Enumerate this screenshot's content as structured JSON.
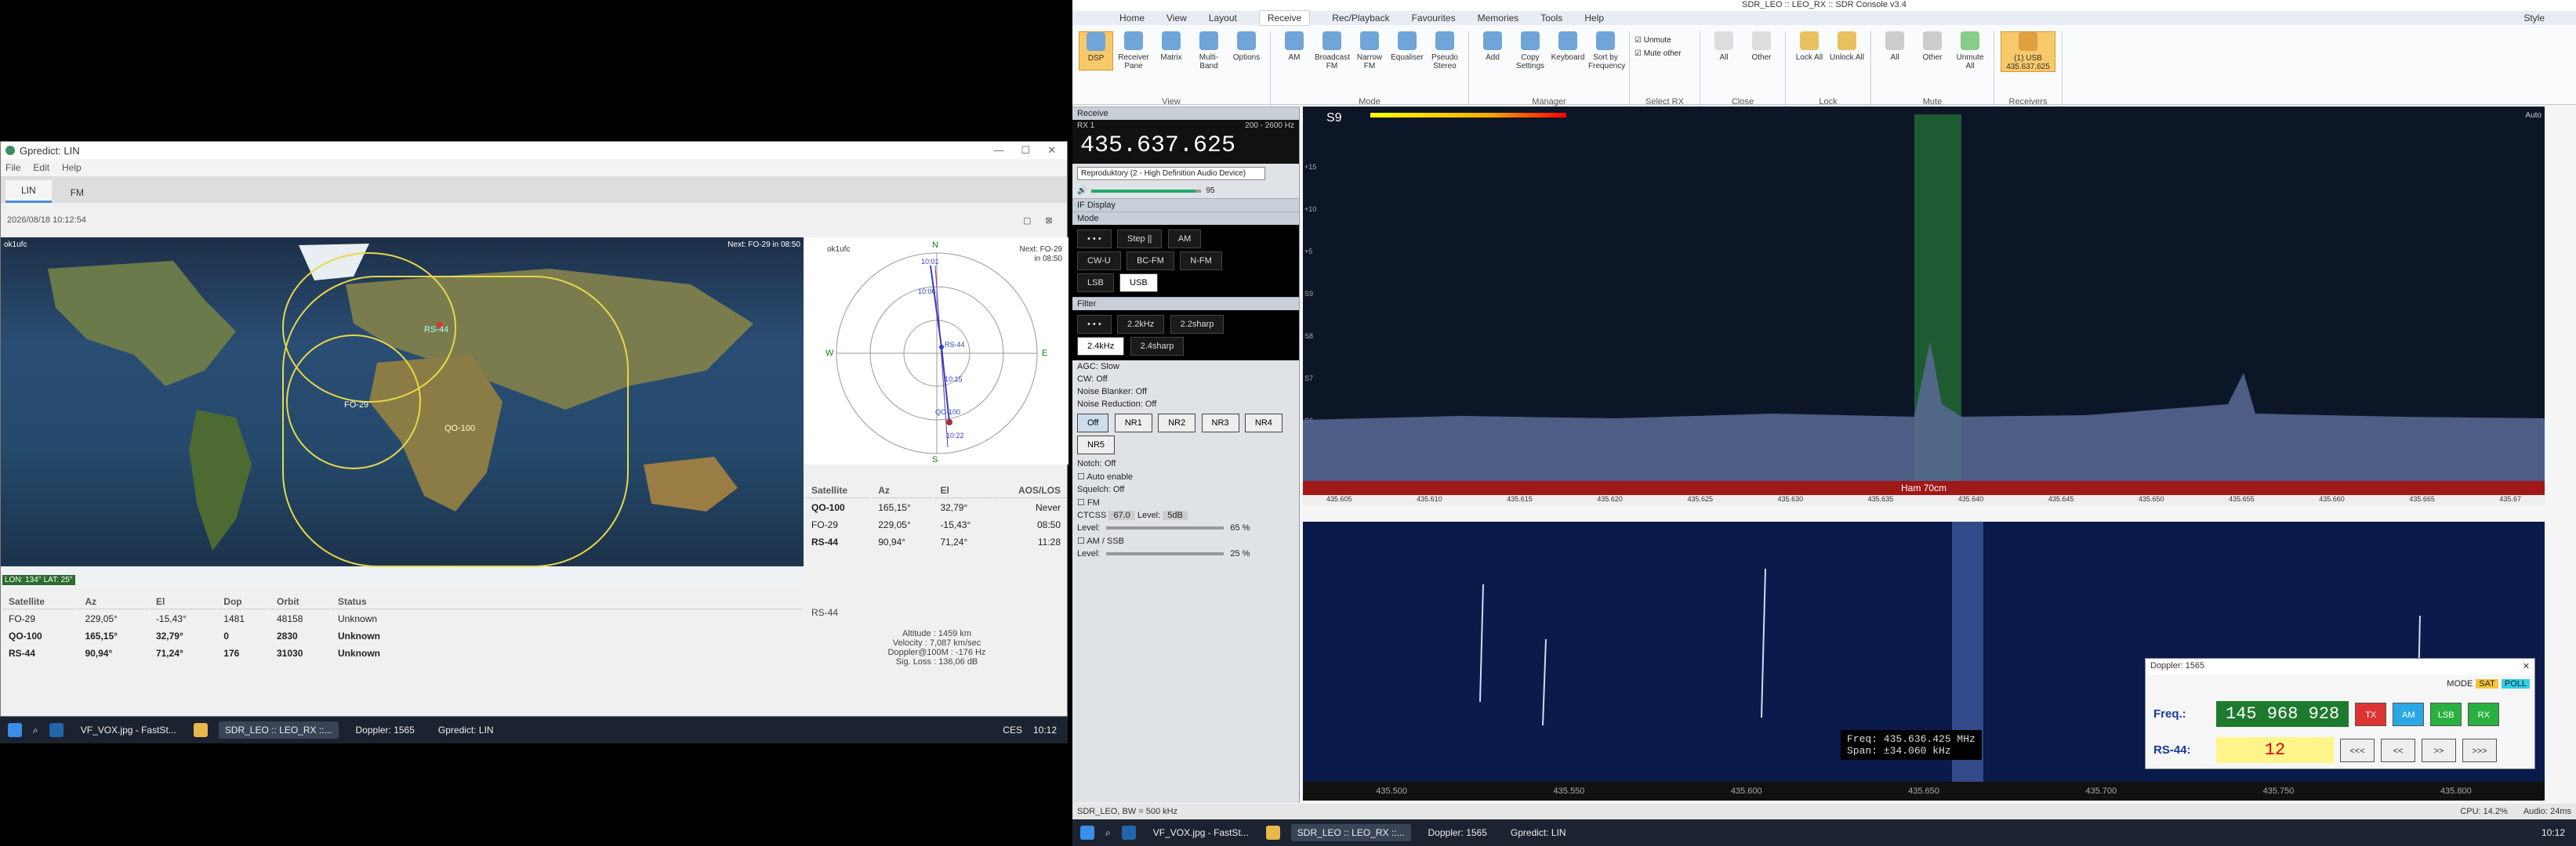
{
  "gpredict": {
    "title": "Gpredict: LIN",
    "menu": [
      "File",
      "Edit",
      "Help"
    ],
    "tabs": [
      "LIN",
      "FM"
    ],
    "datetime": "2026/08/18 10:12:54",
    "map": {
      "qth": "ok1ufc",
      "next": "Next: FO-29 in 08:50",
      "coords": "LON: 134° LAT: 25°",
      "sat_labels": [
        "FO-29",
        "QO-100",
        "RS-44"
      ]
    },
    "polar": {
      "qth": "ok1ufc",
      "next_line1": "Next: FO-29",
      "next_line2": "in 08:50",
      "n": "N",
      "s": "S",
      "e": "E",
      "w": "W",
      "labels": [
        "10:01",
        "10:06",
        "RS-44",
        "10:15",
        "QO-100",
        "10:22"
      ]
    },
    "sky_table": {
      "headers": [
        "Satellite",
        "Az",
        "El",
        "AOS/LOS"
      ],
      "rows": [
        [
          "QO-100",
          "165,15°",
          "32,79°",
          "Never"
        ],
        [
          "FO-29",
          "229,05°",
          "-15,43°",
          "08:50"
        ],
        [
          "RS-44",
          "90,94°",
          "71,24°",
          "11:28"
        ]
      ]
    },
    "list_table": {
      "headers": [
        "Satellite",
        "Az",
        "El",
        "Dop",
        "Orbit",
        "Status"
      ],
      "rows": [
        [
          "FO-29",
          "229,05°",
          "-15,43°",
          "1481",
          "48158",
          "Unknown"
        ],
        [
          "QO-100",
          "165,15°",
          "32,79°",
          "0",
          "2830",
          "Unknown"
        ],
        [
          "RS-44",
          "90,94°",
          "71,24°",
          "176",
          "31030",
          "Unknown"
        ]
      ]
    },
    "details": {
      "name": "RS-44",
      "altitude": "Altitude : 1459 km",
      "velocity": "Velocity : 7,087 km/sec",
      "doppler": "Doppler@100M : -176 Hz",
      "sigloss": "Sig. Loss : 136,06 dB"
    }
  },
  "taskbar_left": {
    "items": [
      "VF_VOX.jpg - FastSt...",
      "SDR_LEO :: LEO_RX ::...",
      "Doppler: 1565",
      "Gpredict: LIN"
    ],
    "lang": "CES",
    "time": "10:12"
  },
  "sdr": {
    "title": "SDR_LEO :: LEO_RX :: SDR Console v3.4",
    "style_label": "Style",
    "tabs": [
      "Home",
      "View",
      "Layout",
      "Receive",
      "Rec/Playback",
      "Favourites",
      "Memories",
      "Tools",
      "Help"
    ],
    "groups": [
      {
        "label": "View",
        "buttons": [
          "DSP",
          "Receiver Pane",
          "Matrix",
          "Multi-Band",
          "Options"
        ]
      },
      {
        "label": "Mode",
        "buttons": [
          "AM",
          "Broadcast FM",
          "Narrow FM",
          "Equaliser",
          "Pseudo Stereo"
        ]
      },
      {
        "label": "Manager",
        "buttons": [
          "Add",
          "Copy Settings",
          "Keyboard",
          "Sort by Frequency"
        ]
      },
      {
        "label": "Select RX",
        "buttons": [
          "Unmute",
          "Mute other"
        ]
      },
      {
        "label": "Close",
        "buttons": [
          "All",
          "Other"
        ]
      },
      {
        "label": "Lock",
        "buttons": [
          "Lock All",
          "Unlock All"
        ]
      },
      {
        "label": "Mute",
        "buttons": [
          "All",
          "Other",
          "Unmute All"
        ]
      },
      {
        "label": "Receivers",
        "buttons": [
          "(1) USB 435.637.625"
        ]
      }
    ],
    "receive_label": "Receive",
    "rx": "RX 1",
    "bw": "200 - 2600 Hz",
    "frequency": "435.637.625",
    "audio_device": "Reproduktory (2 - High Definition Audio Device)",
    "volume": "95",
    "if_display": "IF Display",
    "mode_label": "Mode",
    "modes": [
      "• • •",
      "Step ||",
      "AM",
      "CW-U",
      "BC-FM",
      "N-FM",
      "LSB",
      "USB"
    ],
    "filter_label": "Filter",
    "filters": [
      "• • •",
      "2.2kHz",
      "2.2sharp",
      "2.4kHz",
      "2.4sharp"
    ],
    "agc": "AGC: Slow",
    "cw": "CW: Off",
    "noise_blanker": "Noise Blanker: Off",
    "noise_reduction": "Noise Reduction: Off",
    "nr_buttons": [
      "Off",
      "NR1",
      "NR2",
      "NR3",
      "NR4",
      "NR5"
    ],
    "notch": "Notch: Off",
    "auto_enable": "Auto enable",
    "squelch": "Squelch: Off",
    "fm": "FM",
    "ctcss": "CTCSS",
    "ctcss_val": "67.0",
    "level_label": "Level:",
    "level_val": "5dB",
    "level1": "65 %",
    "amssb": "AM / SSB",
    "level2": "25 %",
    "smeter": "S9",
    "band_label": "Ham 70cm",
    "freq_ticks": [
      "435.605",
      "435.610",
      "435.615",
      "435.620",
      "435.625",
      "435.630",
      "435.635",
      "435.640",
      "435.645",
      "435.650",
      "435.655",
      "435.660",
      "435.665",
      "435.67"
    ],
    "wf_freq": "Freq: 435.636.425 MHz",
    "wf_span": "Span: ±34.060 kHz",
    "wf_ticks": [
      "435.500",
      "435.550",
      "435.600",
      "435.650",
      "435.700",
      "435.750",
      "435.800"
    ],
    "status_left": "SDR_LEO, BW = 500 kHz",
    "status_cpu": "CPU: 14.2%",
    "status_audio": "Audio: 24ms",
    "db_left": [
      "+15",
      "+10",
      "+5",
      "S9",
      "S8",
      "S7",
      "S6",
      "S5"
    ],
    "auto": "Auto"
  },
  "doppler": {
    "title": "Doppler: 1565",
    "mode_label": "MODE",
    "sat": "SAT",
    "poll": "POLL",
    "freq_label": "Freq.:",
    "freq_value": "145 968 928",
    "rs_label": "RS-44:",
    "rs_value": "12",
    "btn_tx": "TX",
    "btn_am": "AM",
    "btn_lsb": "LSB",
    "btn_rx": "RX",
    "nav": [
      "<<<",
      "<<",
      ">>",
      ">>>"
    ]
  },
  "taskbar_right": {
    "items": [
      "VF_VOX.jpg - FastSt...",
      "SDR_LEO :: LEO_RX ::...",
      "Doppler: 1565",
      "Gpredict: LIN"
    ],
    "time": "10:12"
  },
  "colors": {
    "accent": "#4a8fd4",
    "spectrum": "#0d1626",
    "waterfall": "#0a1a4a",
    "dop_freq": "#1e7a2e",
    "dop_rs": "#fff58a"
  }
}
